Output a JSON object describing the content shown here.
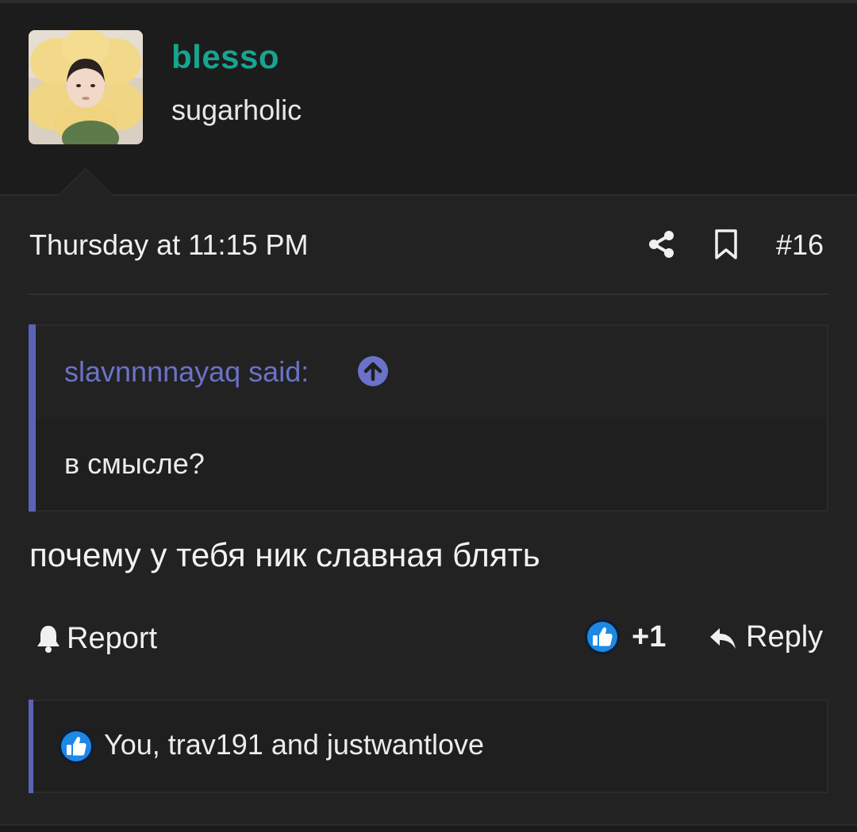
{
  "user": {
    "username": "blesso",
    "title": "sugarholic",
    "avatar_icon": "user-avatar"
  },
  "post": {
    "date": "Thursday at 11:15 PM",
    "number": "#16",
    "share_icon": "share-icon",
    "bookmark_icon": "bookmark-icon",
    "message": "почему у тебя ник славная блять"
  },
  "quote": {
    "author_label": "slavnnnnayaq said:",
    "text": "в смысле?",
    "accent_color": "#5b63b8",
    "author_color": "#6a72c9"
  },
  "actions": {
    "report_label": "Report",
    "like_count": "+1",
    "reply_label": "Reply"
  },
  "reactions": {
    "summary": "You, trav191 and justwantlove"
  },
  "colors": {
    "username": "#17a58f",
    "background": "#1c1c1c",
    "like_blue": "#1e88e5"
  }
}
